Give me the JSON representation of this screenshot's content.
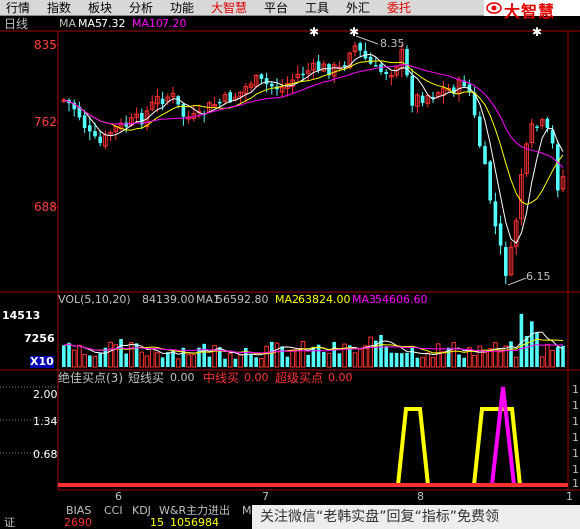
{
  "menu": [
    {
      "label": "行情",
      "color": "#000000"
    },
    {
      "label": "指数",
      "color": "#000000"
    },
    {
      "label": "板块",
      "color": "#000000"
    },
    {
      "label": "分析",
      "color": "#000000"
    },
    {
      "label": "功能",
      "color": "#000000"
    },
    {
      "label": "大智慧",
      "color": "#e00000"
    },
    {
      "label": "平台",
      "color": "#000000"
    },
    {
      "label": "工具",
      "color": "#000000"
    },
    {
      "label": "外汇",
      "color": "#000000"
    },
    {
      "label": "委托",
      "color": "#e00000"
    }
  ],
  "logo": {
    "text": "大智慧",
    "icon": "eye-logo-icon"
  },
  "price_panel": {
    "period_label": "日线",
    "ma_title": "MA",
    "ma5_label": "MA5",
    "ma5_value": "7.32",
    "ma10_label": "MA10",
    "ma10_value": "7.20",
    "y_ticks": [
      "835",
      "762",
      "688"
    ],
    "high_label": "8.35",
    "low_label": "6.15",
    "colors": {
      "up": "#ff3232",
      "down": "#54ffff",
      "ma5": "#ffffff",
      "ma10": "#ffff00",
      "ma20": "#ff00ff"
    }
  },
  "volume_panel": {
    "title": "VOL(5,10,20)",
    "vol_value": "84139.00",
    "ma1_label": "MA1",
    "ma1_value": "56592.80",
    "ma2_label": "MA2",
    "ma2_value": "63824.00",
    "ma3_label": "MA3",
    "ma3_value": "54606.60",
    "y_ticks": [
      "14513",
      "7256",
      "X10"
    ]
  },
  "indicator_panel": {
    "title": "绝佳买点(3)",
    "line1_label": "短线买",
    "line1_value": "0.00",
    "line2_label": "中线买",
    "line2_value": "0.00",
    "line3_label": "超级买点",
    "line3_value": "0.00",
    "y_ticks": [
      "2.00",
      "1.34",
      "0.68"
    ],
    "colors": {
      "line1": "#c0c0c0",
      "line2": "#ff3030",
      "line3": "#ff3030",
      "yellow": "#ffff00",
      "magenta": "#ff00ff"
    }
  },
  "x_axis": {
    "labels": [
      "6",
      "7",
      "8",
      "1"
    ]
  },
  "bottom_tabs": [
    "BIAS",
    "CCI",
    "KDJ",
    "W&R",
    "主力进出",
    "M"
  ],
  "status": {
    "label": "证",
    "value1": "2690",
    "value2": "15",
    "value3": "1056984"
  },
  "watermark": "关注微信“老韩实盘”回复“指标”免费领",
  "right_scale_text": [
    "1",
    "1",
    "1",
    "1",
    "1",
    "1",
    "1"
  ]
}
